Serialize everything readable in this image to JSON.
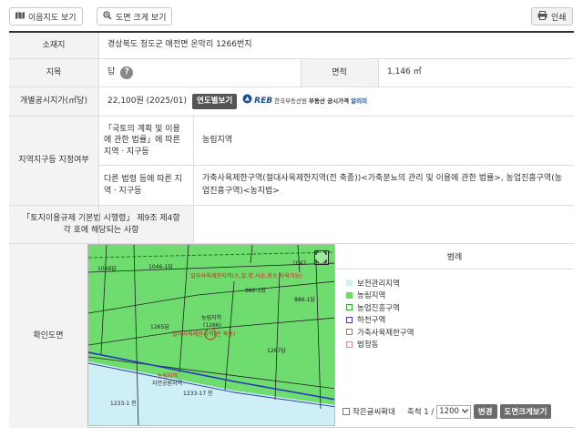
{
  "toolbar": {
    "map_view_label": "이음지도 보기",
    "enlarge_label": "도면 크게 보기",
    "print_label": "인쇄"
  },
  "table": {
    "location": {
      "label": "소재지",
      "value": "경상북도 청도군 매전면 온막리 1266번지"
    },
    "land_category": {
      "label": "지목",
      "value": "답",
      "help": "?"
    },
    "area": {
      "label": "면적",
      "value": "1,146 ㎡"
    },
    "official_price": {
      "label": "개별공시지가(㎡당)",
      "value": "22,100원 (2025/01)",
      "yearly_button": "연도별보기",
      "reb_mark": "REB",
      "reb_org": "한국부동산원",
      "reb_service": "부동산 공시가격",
      "reb_app": "알리미"
    },
    "zone": {
      "label": "지역지구등 지정여부",
      "national_land_label": "「국토의 계획 및 이용에 관한 법률」에 따른 지역ㆍ지구등",
      "national_land_value": "농림지역",
      "other_law_label": "다른 법령 등에 따른 지역ㆍ지구등",
      "other_law_value": "가축사육제한구역(절대사육제한지역(전 축종))<가축분뇨의 관리 및 이용에 관한 법률>, 농업진흥구역(농업진흥구역)<농지법>"
    },
    "enforcement": {
      "label": "「토지이용규제 기본법 시행령」 제9조 제4항 각 호에 해당되는 사항",
      "value": ""
    },
    "map_label": "확인도면"
  },
  "map": {
    "parcels": [
      "1046답",
      "1046-1답",
      "1047",
      "886-1답",
      "886-1답",
      "1265답",
      "1266답",
      "1267답",
      "1233-17 천",
      "1233-1 천"
    ],
    "overlay_top": "일부사육제한지역(소,말,양,사슴,장소 사육가능)",
    "overlay_mid": "절대사육제한지역(전 축종)",
    "center_label_1": "농림지역",
    "center_label_2": "(1266)",
    "bottom_label_1": "농림지역",
    "bottom_label_2": "자연공원지역",
    "fullscreen_icon": "fullscreen-icon"
  },
  "legend": {
    "title": "범례",
    "items": [
      {
        "label": "보전관리지역",
        "color": "#cfeff6",
        "border": "#cfeff6"
      },
      {
        "label": "농림지역",
        "color": "#66dd66",
        "border": "#66dd66"
      },
      {
        "label": "농업진흥구역",
        "color": "#ffffff",
        "border": "#33aa33"
      },
      {
        "label": "하천구역",
        "color": "#ffffff",
        "border": "#4a3aa8"
      },
      {
        "label": "가축사육제한구역",
        "color": "#ffffff",
        "border": "#888888"
      },
      {
        "label": "법정동",
        "color": "#ffffff",
        "border": "#e08a8a"
      }
    ]
  },
  "controls": {
    "small_text_label": "작은글씨확대",
    "scale_label": "축척 1 /",
    "scale_value": "1200",
    "change_button": "변경",
    "enlarge_button": "도면크게보기"
  },
  "colors": {
    "accent": "#1a4f9c",
    "map_green": "#6fdc6f",
    "river": "#cfeff6"
  }
}
